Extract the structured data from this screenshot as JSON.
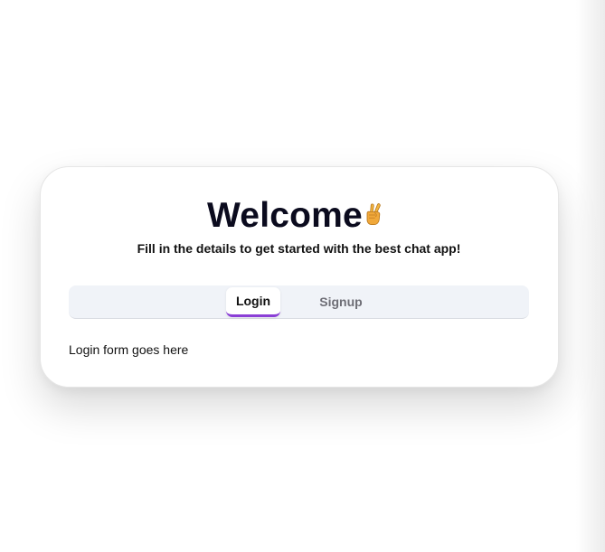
{
  "card": {
    "title": "Welcome",
    "title_icon": "victory-hand-icon",
    "subtitle": "Fill in the details to get started with the best chat app!"
  },
  "tabs": {
    "items": [
      {
        "label": "Login",
        "selected": true
      },
      {
        "label": "Signup",
        "selected": false
      }
    ],
    "accent_color": "#8b3fd6"
  },
  "content": {
    "text": "Login form goes here"
  }
}
